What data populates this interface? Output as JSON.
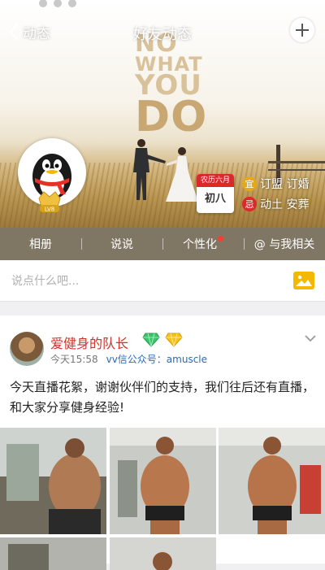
{
  "nav": {
    "back_label": "动态",
    "title": "好友动态"
  },
  "cover": {
    "watermark": [
      "NO",
      "WHAT",
      "YOU",
      "DO"
    ]
  },
  "profile": {
    "level_badge": "LV8"
  },
  "calendar": {
    "month": "农历六月",
    "day": "初八"
  },
  "almanac": [
    {
      "tag": "宜",
      "text": "订盟 订婚",
      "color": "#e6a817"
    },
    {
      "tag": "忌",
      "text": "动土 安葬",
      "color": "#d9292b"
    }
  ],
  "tabs": [
    {
      "label": "相册",
      "dot": false
    },
    {
      "label": "说说",
      "dot": false
    },
    {
      "label": "个性化",
      "dot": true
    },
    {
      "label": "@ 与我相关",
      "dot": false
    }
  ],
  "compose": {
    "placeholder": "说点什么吧..."
  },
  "post": {
    "author": "爱健身的队长",
    "time": "今天15:58",
    "source": "vv信公众号：amuscle",
    "text": "今天直播花絮，谢谢伙伴们的支持，我们往后还有直播，和大家分享健身经验!"
  },
  "colors": {
    "accent_red": "#d0312d",
    "link_blue": "#2c69b5",
    "tab_bar": "#6e6450",
    "photo_button": "#f5b800"
  }
}
